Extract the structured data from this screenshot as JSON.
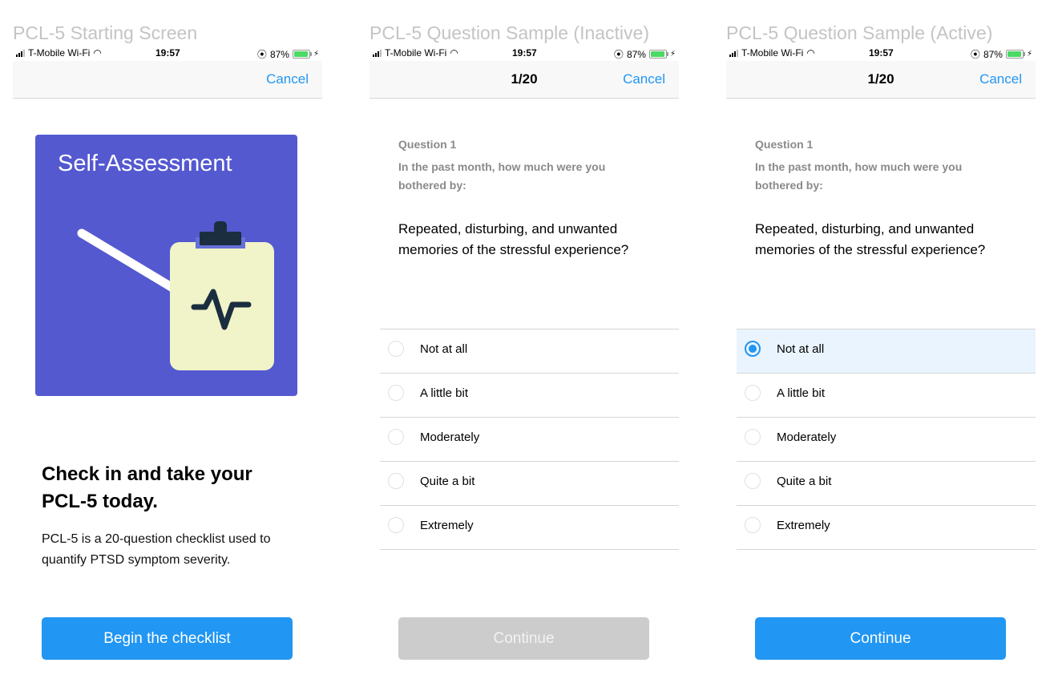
{
  "status_bar": {
    "carrier": "T-Mobile Wi-Fi",
    "time": "19:57",
    "battery": "87%",
    "battery_level": 0.87
  },
  "colors": {
    "accent": "#2196f3",
    "hero_bg": "#5459d0",
    "disabled": "#cccccc",
    "selected_row": "#eaf4fe"
  },
  "screens": [
    {
      "title": "PCL-5 Starting Screen",
      "nav_cancel": "Cancel",
      "hero_title": "Self-Assessment",
      "hero_icon": "clipboard-pencil-heartbeat-illustration",
      "headline": "Check in and take your PCL-5 today.",
      "description": "PCL-5 is a 20-question checklist used to quantify PTSD symptom severity.",
      "button": "Begin the checklist"
    },
    {
      "title": "PCL-5 Question Sample (Inactive)",
      "nav_title": "1/20",
      "nav_cancel": "Cancel",
      "question_number": "Question 1",
      "prompt": "In the past month, how much were you bothered by:",
      "question": "Repeated, disturbing, and unwanted memories of the stressful experience?",
      "options": [
        "Not at all",
        "A little bit",
        "Moderately",
        "Quite a bit",
        "Extremely"
      ],
      "selected": null,
      "button": "Continue",
      "button_enabled": false
    },
    {
      "title": "PCL-5 Question Sample (Active)",
      "nav_title": "1/20",
      "nav_cancel": "Cancel",
      "question_number": "Question 1",
      "prompt": "In the past month, how much were you bothered by:",
      "question": "Repeated, disturbing, and unwanted memories of the stressful experience?",
      "options": [
        "Not at all",
        "A little bit",
        "Moderately",
        "Quite a bit",
        "Extremely"
      ],
      "selected": "Not at all",
      "button": "Continue",
      "button_enabled": true
    }
  ]
}
